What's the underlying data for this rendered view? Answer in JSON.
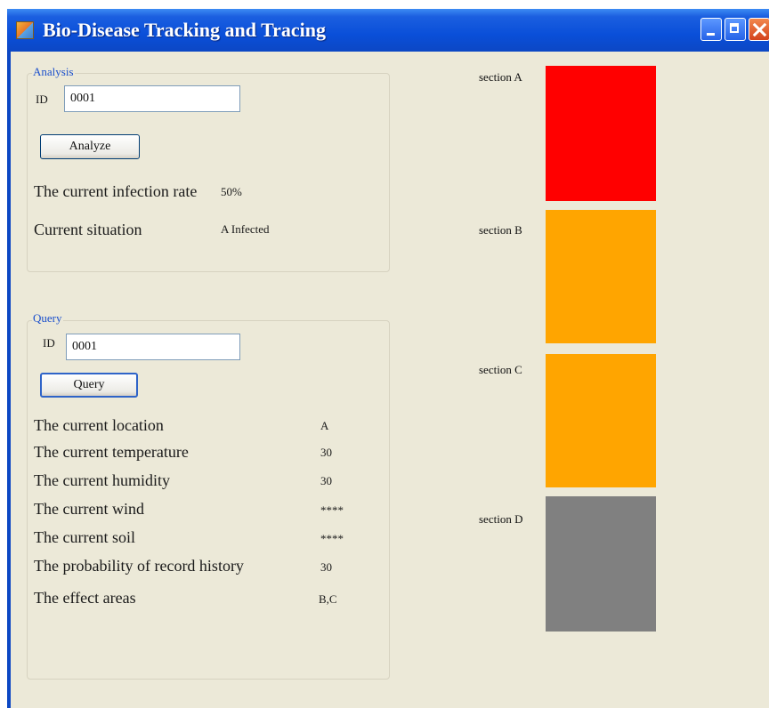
{
  "window": {
    "title": "Bio-Disease Tracking and Tracing"
  },
  "analysis": {
    "group_title": "Analysis",
    "id_label": "ID",
    "id_value": "0001",
    "button_label": "Analyze",
    "infection_rate_label": "The current infection rate",
    "infection_rate_value": "50%",
    "situation_label": "Current situation",
    "situation_value": "A Infected"
  },
  "query": {
    "group_title": "Query",
    "id_label": "ID",
    "id_value": "0001",
    "button_label": "Query",
    "rows": [
      {
        "label": "The current location",
        "value": "A"
      },
      {
        "label": "The current temperature",
        "value": "30"
      },
      {
        "label": "The current humidity",
        "value": "30"
      },
      {
        "label": "The current wind",
        "value": "****"
      },
      {
        "label": "The current soil",
        "value": "****"
      },
      {
        "label": "The probability of record history",
        "value": "30"
      },
      {
        "label": "The effect areas",
        "value": "B,C"
      }
    ]
  },
  "sections": [
    {
      "label": "section A",
      "color": "#ff0000"
    },
    {
      "label": "section B",
      "color": "#ffa500"
    },
    {
      "label": "section C",
      "color": "#ffa500"
    },
    {
      "label": "section D",
      "color": "#808080"
    }
  ]
}
